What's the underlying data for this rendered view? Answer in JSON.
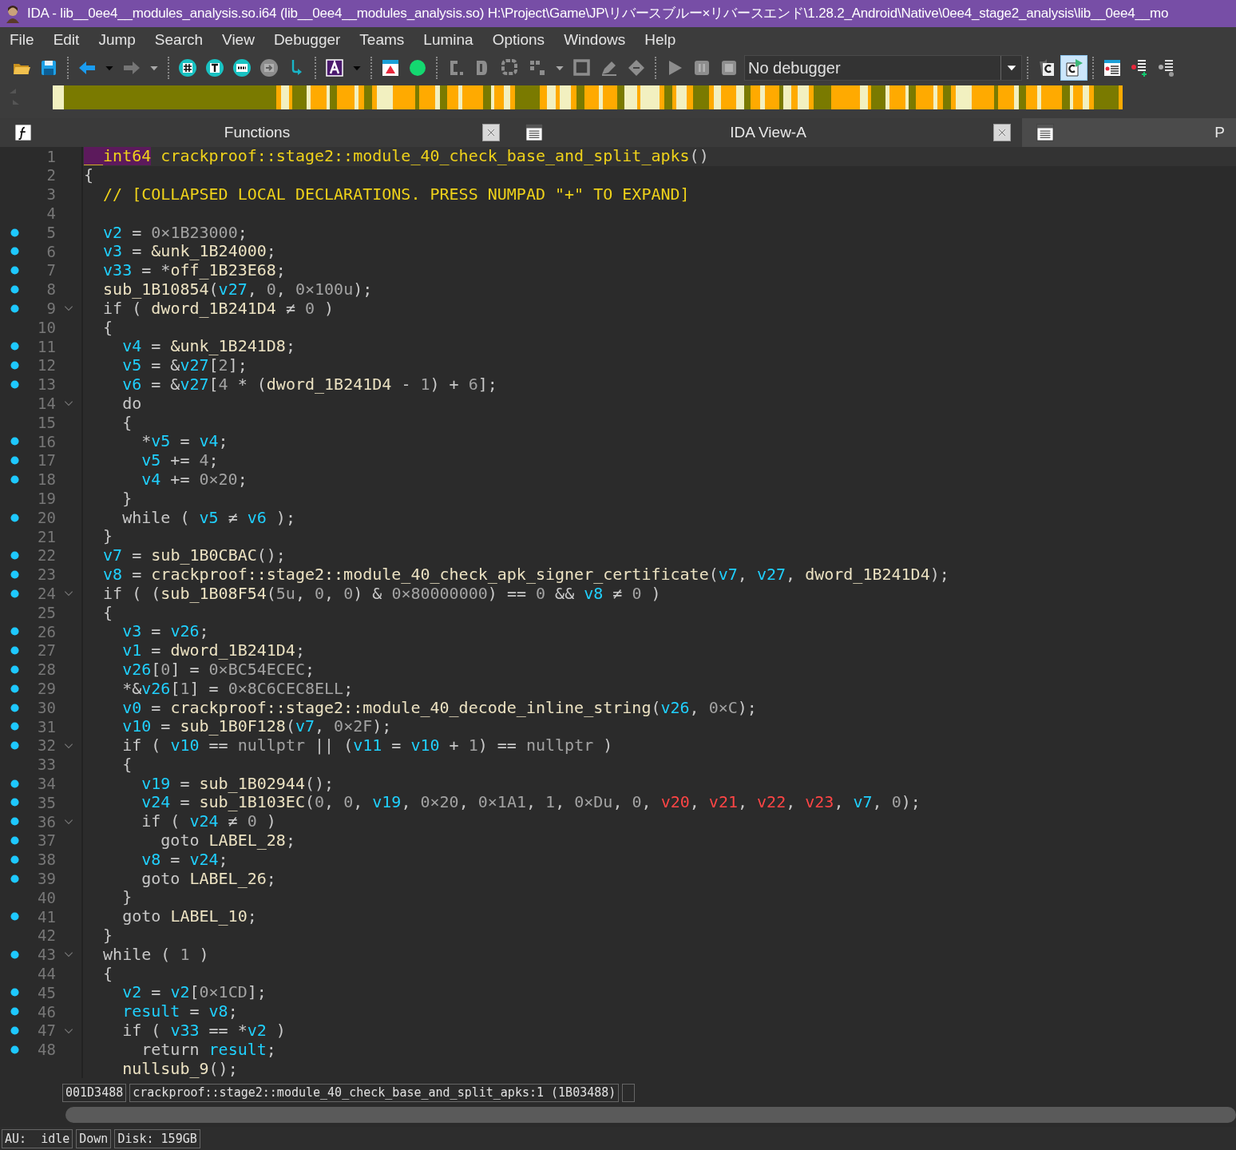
{
  "window": {
    "title": "IDA - lib__0ee4__modules_analysis.so.i64 (lib__0ee4__modules_analysis.so) H:\\Project\\Game\\JP\\リバースブルー×リバースエンド\\1.28.2_Android\\Native\\0ee4_stage2_analysis\\lib__0ee4__mo"
  },
  "menu": [
    "File",
    "Edit",
    "Jump",
    "Search",
    "View",
    "Debugger",
    "Teams",
    "Lumina",
    "Options",
    "Windows",
    "Help"
  ],
  "toolbar": [
    {
      "kind": "open",
      "disabled": false,
      "pressed": false
    },
    {
      "kind": "save",
      "disabled": false,
      "pressed": false
    },
    {
      "kind": "sep"
    },
    {
      "kind": "back",
      "disabled": false,
      "pressed": false
    },
    {
      "kind": "caret",
      "disabled": false,
      "pressed": false
    },
    {
      "kind": "forward",
      "disabled": true,
      "pressed": false
    },
    {
      "kind": "caret",
      "disabled": true,
      "pressed": false
    },
    {
      "kind": "sep"
    },
    {
      "kind": "hash",
      "disabled": false,
      "pressed": false
    },
    {
      "kind": "text",
      "disabled": false,
      "pressed": false
    },
    {
      "kind": "binary",
      "disabled": false,
      "pressed": false
    },
    {
      "kind": "jump",
      "disabled": true,
      "pressed": false
    },
    {
      "kind": "step",
      "disabled": false,
      "pressed": false
    },
    {
      "kind": "sep"
    },
    {
      "kind": "color",
      "disabled": false,
      "pressed": false
    },
    {
      "kind": "caret",
      "disabled": false,
      "pressed": false
    },
    {
      "kind": "sep"
    },
    {
      "kind": "flag",
      "disabled": false,
      "pressed": false
    },
    {
      "kind": "dot",
      "disabled": false,
      "pressed": false
    },
    {
      "kind": "sep"
    },
    {
      "kind": "code",
      "disabled": true,
      "pressed": false
    },
    {
      "kind": "data",
      "disabled": true,
      "pressed": false
    },
    {
      "kind": "struct",
      "disabled": true,
      "pressed": false
    },
    {
      "kind": "array",
      "disabled": true,
      "pressed": false
    },
    {
      "kind": "caret",
      "disabled": true,
      "pressed": false
    },
    {
      "kind": "bracket",
      "disabled": true,
      "pressed": false
    },
    {
      "kind": "pencil",
      "disabled": true,
      "pressed": false
    },
    {
      "kind": "diamond",
      "disabled": true,
      "pressed": false
    },
    {
      "kind": "sep"
    },
    {
      "kind": "play",
      "disabled": true,
      "pressed": false
    },
    {
      "kind": "pause",
      "disabled": true,
      "pressed": false
    },
    {
      "kind": "stop",
      "disabled": true,
      "pressed": false
    },
    {
      "kind": "select",
      "value": "No debugger"
    },
    {
      "kind": "sep"
    },
    {
      "kind": "doc-back",
      "disabled": false,
      "pressed": false
    },
    {
      "kind": "doc-play",
      "disabled": false,
      "pressed": true
    },
    {
      "kind": "sep"
    },
    {
      "kind": "list",
      "disabled": false,
      "pressed": false
    },
    {
      "kind": "list-add",
      "disabled": false,
      "pressed": false
    },
    {
      "kind": "list-gear",
      "disabled": false,
      "pressed": false
    }
  ],
  "tabs": [
    {
      "kind": "functions",
      "label": "Functions",
      "selected": false,
      "closable": true
    },
    {
      "kind": "view",
      "label": "IDA View-A",
      "selected": false,
      "closable": true
    },
    {
      "kind": "view",
      "label": "P",
      "selected": true,
      "closable": false
    }
  ],
  "code": [
    {
      "number": "1",
      "marker": false,
      "foldable": false,
      "selected": true,
      "tokens": [
        {
          "kind": "t",
          "text": "__int64"
        },
        {
          "kind": "c",
          "text": " crackproof::stage2::module_40_check_base_and_split_apks"
        },
        {
          "kind": "p",
          "text": "()"
        }
      ]
    },
    {
      "number": "2",
      "marker": false,
      "foldable": false,
      "selected": false,
      "tokens": [
        {
          "kind": "p",
          "text": "{"
        }
      ]
    },
    {
      "number": "3",
      "marker": false,
      "foldable": false,
      "selected": false,
      "tokens": [
        {
          "kind": "c",
          "text": "  // [COLLAPSED LOCAL DECLARATIONS. PRESS NUMPAD \"+\" TO EXPAND]"
        }
      ]
    },
    {
      "number": "4",
      "marker": false,
      "foldable": false,
      "selected": false
    },
    {
      "number": "5",
      "marker": true,
      "foldable": false,
      "selected": false,
      "tokens": [
        {
          "kind": "v",
          "text": "  v2"
        },
        {
          "kind": "p",
          "text": " = "
        },
        {
          "kind": "n",
          "text": "0×1B23000"
        },
        {
          "kind": "p",
          "text": ";"
        }
      ]
    },
    {
      "number": "6",
      "marker": true,
      "foldable": false,
      "selected": false,
      "tokens": [
        {
          "kind": "v",
          "text": "  v3"
        },
        {
          "kind": "p",
          "text": " = "
        },
        {
          "kind": "g",
          "text": "&unk_1B24000"
        },
        {
          "kind": "p",
          "text": ";"
        }
      ]
    },
    {
      "number": "7",
      "marker": true,
      "foldable": false,
      "selected": false,
      "tokens": [
        {
          "kind": "v",
          "text": "  v33"
        },
        {
          "kind": "p",
          "text": " = *"
        },
        {
          "kind": "g",
          "text": "off_1B23E68"
        },
        {
          "kind": "p",
          "text": ";"
        }
      ]
    },
    {
      "number": "8",
      "marker": true,
      "foldable": false,
      "selected": false,
      "tokens": [
        {
          "kind": "g",
          "text": "  sub_1B10854"
        },
        {
          "kind": "p",
          "text": "("
        },
        {
          "kind": "v",
          "text": "v27"
        },
        {
          "kind": "p",
          "text": ", "
        },
        {
          "kind": "n",
          "text": "0"
        },
        {
          "kind": "p",
          "text": ", "
        },
        {
          "kind": "n",
          "text": "0×100u"
        },
        {
          "kind": "p",
          "text": ");"
        }
      ]
    },
    {
      "number": "9",
      "marker": true,
      "foldable": true,
      "selected": false,
      "tokens": [
        {
          "kind": "p",
          "text": "  if ( "
        },
        {
          "kind": "g",
          "text": "dword_1B241D4"
        },
        {
          "kind": "p",
          "text": " ≠ "
        },
        {
          "kind": "n",
          "text": "0"
        },
        {
          "kind": "p",
          "text": " )"
        }
      ]
    },
    {
      "number": "10",
      "marker": false,
      "foldable": false,
      "selected": false,
      "tokens": [
        {
          "kind": "p",
          "text": "  {"
        }
      ]
    },
    {
      "number": "11",
      "marker": true,
      "foldable": false,
      "selected": false,
      "tokens": [
        {
          "kind": "v",
          "text": "    v4"
        },
        {
          "kind": "p",
          "text": " = "
        },
        {
          "kind": "g",
          "text": "&unk_1B241D8"
        },
        {
          "kind": "p",
          "text": ";"
        }
      ]
    },
    {
      "number": "12",
      "marker": true,
      "foldable": false,
      "selected": false,
      "tokens": [
        {
          "kind": "v",
          "text": "    v5"
        },
        {
          "kind": "p",
          "text": " = &"
        },
        {
          "kind": "v",
          "text": "v27"
        },
        {
          "kind": "p",
          "text": "["
        },
        {
          "kind": "n",
          "text": "2"
        },
        {
          "kind": "p",
          "text": "];"
        }
      ]
    },
    {
      "number": "13",
      "marker": true,
      "foldable": false,
      "selected": false,
      "tokens": [
        {
          "kind": "v",
          "text": "    v6"
        },
        {
          "kind": "p",
          "text": " = &"
        },
        {
          "kind": "v",
          "text": "v27"
        },
        {
          "kind": "p",
          "text": "["
        },
        {
          "kind": "n",
          "text": "4"
        },
        {
          "kind": "p",
          "text": " * ("
        },
        {
          "kind": "g",
          "text": "dword_1B241D4"
        },
        {
          "kind": "p",
          "text": " - "
        },
        {
          "kind": "n",
          "text": "1"
        },
        {
          "kind": "p",
          "text": ") + "
        },
        {
          "kind": "n",
          "text": "6"
        },
        {
          "kind": "p",
          "text": "];"
        }
      ]
    },
    {
      "number": "14",
      "marker": false,
      "foldable": true,
      "selected": false,
      "tokens": [
        {
          "kind": "p",
          "text": "    do"
        }
      ]
    },
    {
      "number": "15",
      "marker": false,
      "foldable": false,
      "selected": false,
      "tokens": [
        {
          "kind": "p",
          "text": "    {"
        }
      ]
    },
    {
      "number": "16",
      "marker": true,
      "foldable": false,
      "selected": false,
      "tokens": [
        {
          "kind": "p",
          "text": "      *"
        },
        {
          "kind": "v",
          "text": "v5"
        },
        {
          "kind": "p",
          "text": " = "
        },
        {
          "kind": "v",
          "text": "v4"
        },
        {
          "kind": "p",
          "text": ";"
        }
      ]
    },
    {
      "number": "17",
      "marker": true,
      "foldable": false,
      "selected": false,
      "tokens": [
        {
          "kind": "v",
          "text": "      v5"
        },
        {
          "kind": "p",
          "text": " += "
        },
        {
          "kind": "n",
          "text": "4"
        },
        {
          "kind": "p",
          "text": ";"
        }
      ]
    },
    {
      "number": "18",
      "marker": true,
      "foldable": false,
      "selected": false,
      "tokens": [
        {
          "kind": "v",
          "text": "      v4"
        },
        {
          "kind": "p",
          "text": " += "
        },
        {
          "kind": "n",
          "text": "0×20"
        },
        {
          "kind": "p",
          "text": ";"
        }
      ]
    },
    {
      "number": "19",
      "marker": false,
      "foldable": false,
      "selected": false,
      "tokens": [
        {
          "kind": "p",
          "text": "    }"
        }
      ]
    },
    {
      "number": "20",
      "marker": true,
      "foldable": false,
      "selected": false,
      "tokens": [
        {
          "kind": "p",
          "text": "    while ( "
        },
        {
          "kind": "v",
          "text": "v5"
        },
        {
          "kind": "p",
          "text": " ≠ "
        },
        {
          "kind": "v",
          "text": "v6"
        },
        {
          "kind": "p",
          "text": " );"
        }
      ]
    },
    {
      "number": "21",
      "marker": false,
      "foldable": false,
      "selected": false,
      "tokens": [
        {
          "kind": "p",
          "text": "  }"
        }
      ]
    },
    {
      "number": "22",
      "marker": true,
      "foldable": false,
      "selected": false,
      "tokens": [
        {
          "kind": "v",
          "text": "  v7"
        },
        {
          "kind": "p",
          "text": " = "
        },
        {
          "kind": "g",
          "text": "sub_1B0CBAC"
        },
        {
          "kind": "p",
          "text": "();"
        }
      ]
    },
    {
      "number": "23",
      "marker": true,
      "foldable": false,
      "selected": false,
      "tokens": [
        {
          "kind": "v",
          "text": "  v8"
        },
        {
          "kind": "p",
          "text": " = "
        },
        {
          "kind": "g",
          "text": "crackproof::stage2::module_40_check_apk_signer_certificate"
        },
        {
          "kind": "p",
          "text": "("
        },
        {
          "kind": "v",
          "text": "v7"
        },
        {
          "kind": "p",
          "text": ", "
        },
        {
          "kind": "v",
          "text": "v27"
        },
        {
          "kind": "p",
          "text": ", "
        },
        {
          "kind": "g",
          "text": "dword_1B241D4"
        },
        {
          "kind": "p",
          "text": ");"
        }
      ]
    },
    {
      "number": "24",
      "marker": true,
      "foldable": true,
      "selected": false,
      "tokens": [
        {
          "kind": "p",
          "text": "  if ( ("
        },
        {
          "kind": "g",
          "text": "sub_1B08F54"
        },
        {
          "kind": "p",
          "text": "("
        },
        {
          "kind": "n",
          "text": "5u"
        },
        {
          "kind": "p",
          "text": ", "
        },
        {
          "kind": "n",
          "text": "0"
        },
        {
          "kind": "p",
          "text": ", "
        },
        {
          "kind": "n",
          "text": "0"
        },
        {
          "kind": "p",
          "text": ") & "
        },
        {
          "kind": "n",
          "text": "0×80000000"
        },
        {
          "kind": "p",
          "text": ") == "
        },
        {
          "kind": "n",
          "text": "0"
        },
        {
          "kind": "p",
          "text": " && "
        },
        {
          "kind": "v",
          "text": "v8"
        },
        {
          "kind": "p",
          "text": " ≠ "
        },
        {
          "kind": "n",
          "text": "0"
        },
        {
          "kind": "p",
          "text": " )"
        }
      ]
    },
    {
      "number": "25",
      "marker": false,
      "foldable": false,
      "selected": false,
      "tokens": [
        {
          "kind": "p",
          "text": "  {"
        }
      ]
    },
    {
      "number": "26",
      "marker": true,
      "foldable": false,
      "selected": false,
      "tokens": [
        {
          "kind": "v",
          "text": "    v3"
        },
        {
          "kind": "p",
          "text": " = "
        },
        {
          "kind": "v",
          "text": "v26"
        },
        {
          "kind": "p",
          "text": ";"
        }
      ]
    },
    {
      "number": "27",
      "marker": true,
      "foldable": false,
      "selected": false,
      "tokens": [
        {
          "kind": "v",
          "text": "    v1"
        },
        {
          "kind": "p",
          "text": " = "
        },
        {
          "kind": "g",
          "text": "dword_1B241D4"
        },
        {
          "kind": "p",
          "text": ";"
        }
      ]
    },
    {
      "number": "28",
      "marker": true,
      "foldable": false,
      "selected": false,
      "tokens": [
        {
          "kind": "v",
          "text": "    v26"
        },
        {
          "kind": "p",
          "text": "["
        },
        {
          "kind": "n",
          "text": "0"
        },
        {
          "kind": "p",
          "text": "] = "
        },
        {
          "kind": "n",
          "text": "0×BC54ECEC"
        },
        {
          "kind": "p",
          "text": ";"
        }
      ]
    },
    {
      "number": "29",
      "marker": true,
      "foldable": false,
      "selected": false,
      "tokens": [
        {
          "kind": "p",
          "text": "    *&"
        },
        {
          "kind": "v",
          "text": "v26"
        },
        {
          "kind": "p",
          "text": "["
        },
        {
          "kind": "n",
          "text": "1"
        },
        {
          "kind": "p",
          "text": "] = "
        },
        {
          "kind": "n",
          "text": "0×8C6CEC8ELL"
        },
        {
          "kind": "p",
          "text": ";"
        }
      ]
    },
    {
      "number": "30",
      "marker": true,
      "foldable": false,
      "selected": false,
      "tokens": [
        {
          "kind": "v",
          "text": "    v0"
        },
        {
          "kind": "p",
          "text": " = "
        },
        {
          "kind": "g",
          "text": "crackproof::stage2::module_40_decode_inline_string"
        },
        {
          "kind": "p",
          "text": "("
        },
        {
          "kind": "v",
          "text": "v26"
        },
        {
          "kind": "p",
          "text": ", "
        },
        {
          "kind": "n",
          "text": "0×C"
        },
        {
          "kind": "p",
          "text": ");"
        }
      ]
    },
    {
      "number": "31",
      "marker": true,
      "foldable": false,
      "selected": false,
      "tokens": [
        {
          "kind": "v",
          "text": "    v10"
        },
        {
          "kind": "p",
          "text": " = "
        },
        {
          "kind": "g",
          "text": "sub_1B0F128"
        },
        {
          "kind": "p",
          "text": "("
        },
        {
          "kind": "v",
          "text": "v7"
        },
        {
          "kind": "p",
          "text": ", "
        },
        {
          "kind": "n",
          "text": "0×2F"
        },
        {
          "kind": "p",
          "text": ");"
        }
      ]
    },
    {
      "number": "32",
      "marker": true,
      "foldable": true,
      "selected": false,
      "tokens": [
        {
          "kind": "p",
          "text": "    if ( "
        },
        {
          "kind": "v",
          "text": "v10"
        },
        {
          "kind": "p",
          "text": " == "
        },
        {
          "kind": "n",
          "text": "nullptr"
        },
        {
          "kind": "p",
          "text": " || ("
        },
        {
          "kind": "v",
          "text": "v11"
        },
        {
          "kind": "p",
          "text": " = "
        },
        {
          "kind": "v",
          "text": "v10"
        },
        {
          "kind": "p",
          "text": " + "
        },
        {
          "kind": "n",
          "text": "1"
        },
        {
          "kind": "p",
          "text": ") == "
        },
        {
          "kind": "n",
          "text": "nullptr"
        },
        {
          "kind": "p",
          "text": " )"
        }
      ]
    },
    {
      "number": "33",
      "marker": false,
      "foldable": false,
      "selected": false,
      "tokens": [
        {
          "kind": "p",
          "text": "    {"
        }
      ]
    },
    {
      "number": "34",
      "marker": true,
      "foldable": false,
      "selected": false,
      "tokens": [
        {
          "kind": "v",
          "text": "      v19"
        },
        {
          "kind": "p",
          "text": " = "
        },
        {
          "kind": "g",
          "text": "sub_1B02944"
        },
        {
          "kind": "p",
          "text": "();"
        }
      ]
    },
    {
      "number": "35",
      "marker": true,
      "foldable": false,
      "selected": false,
      "tokens": [
        {
          "kind": "v",
          "text": "      v24"
        },
        {
          "kind": "p",
          "text": " = "
        },
        {
          "kind": "g",
          "text": "sub_1B103EC"
        },
        {
          "kind": "p",
          "text": "("
        },
        {
          "kind": "n",
          "text": "0"
        },
        {
          "kind": "p",
          "text": ", "
        },
        {
          "kind": "n",
          "text": "0"
        },
        {
          "kind": "p",
          "text": ", "
        },
        {
          "kind": "v",
          "text": "v19"
        },
        {
          "kind": "p",
          "text": ", "
        },
        {
          "kind": "n",
          "text": "0×20"
        },
        {
          "kind": "p",
          "text": ", "
        },
        {
          "kind": "n",
          "text": "0×1A1"
        },
        {
          "kind": "p",
          "text": ", "
        },
        {
          "kind": "n",
          "text": "1"
        },
        {
          "kind": "p",
          "text": ", "
        },
        {
          "kind": "n",
          "text": "0×Du"
        },
        {
          "kind": "p",
          "text": ", "
        },
        {
          "kind": "n",
          "text": "0"
        },
        {
          "kind": "p",
          "text": ", "
        },
        {
          "kind": "r",
          "text": "v20"
        },
        {
          "kind": "p",
          "text": ", "
        },
        {
          "kind": "r",
          "text": "v21"
        },
        {
          "kind": "p",
          "text": ", "
        },
        {
          "kind": "r",
          "text": "v22"
        },
        {
          "kind": "p",
          "text": ", "
        },
        {
          "kind": "r",
          "text": "v23"
        },
        {
          "kind": "p",
          "text": ", "
        },
        {
          "kind": "v",
          "text": "v7"
        },
        {
          "kind": "p",
          "text": ", "
        },
        {
          "kind": "n",
          "text": "0"
        },
        {
          "kind": "p",
          "text": ");"
        }
      ]
    },
    {
      "number": "36",
      "marker": true,
      "foldable": true,
      "selected": false,
      "tokens": [
        {
          "kind": "p",
          "text": "      if ( "
        },
        {
          "kind": "v",
          "text": "v24"
        },
        {
          "kind": "p",
          "text": " ≠ "
        },
        {
          "kind": "n",
          "text": "0"
        },
        {
          "kind": "p",
          "text": " )"
        }
      ]
    },
    {
      "number": "37",
      "marker": true,
      "foldable": false,
      "selected": false,
      "tokens": [
        {
          "kind": "p",
          "text": "        goto "
        },
        {
          "kind": "g",
          "text": "LABEL_28"
        },
        {
          "kind": "p",
          "text": ";"
        }
      ]
    },
    {
      "number": "38",
      "marker": true,
      "foldable": false,
      "selected": false,
      "tokens": [
        {
          "kind": "v",
          "text": "      v8"
        },
        {
          "kind": "p",
          "text": " = "
        },
        {
          "kind": "v",
          "text": "v24"
        },
        {
          "kind": "p",
          "text": ";"
        }
      ]
    },
    {
      "number": "39",
      "marker": true,
      "foldable": false,
      "selected": false,
      "tokens": [
        {
          "kind": "p",
          "text": "      goto "
        },
        {
          "kind": "g",
          "text": "LABEL_26"
        },
        {
          "kind": "p",
          "text": ";"
        }
      ]
    },
    {
      "number": "40",
      "marker": false,
      "foldable": false,
      "selected": false,
      "tokens": [
        {
          "kind": "p",
          "text": "    }"
        }
      ]
    },
    {
      "number": "41",
      "marker": true,
      "foldable": false,
      "selected": false,
      "tokens": [
        {
          "kind": "p",
          "text": "    goto "
        },
        {
          "kind": "g",
          "text": "LABEL_10"
        },
        {
          "kind": "p",
          "text": ";"
        }
      ]
    },
    {
      "number": "42",
      "marker": false,
      "foldable": false,
      "selected": false,
      "tokens": [
        {
          "kind": "p",
          "text": "  }"
        }
      ]
    },
    {
      "number": "43",
      "marker": true,
      "foldable": true,
      "selected": false,
      "tokens": [
        {
          "kind": "p",
          "text": "  while ( "
        },
        {
          "kind": "n",
          "text": "1"
        },
        {
          "kind": "p",
          "text": " )"
        }
      ]
    },
    {
      "number": "44",
      "marker": false,
      "foldable": false,
      "selected": false,
      "tokens": [
        {
          "kind": "p",
          "text": "  {"
        }
      ]
    },
    {
      "number": "45",
      "marker": true,
      "foldable": false,
      "selected": false,
      "tokens": [
        {
          "kind": "v",
          "text": "    v2"
        },
        {
          "kind": "p",
          "text": " = "
        },
        {
          "kind": "v",
          "text": "v2"
        },
        {
          "kind": "p",
          "text": "["
        },
        {
          "kind": "n",
          "text": "0×1CD"
        },
        {
          "kind": "p",
          "text": "];"
        }
      ]
    },
    {
      "number": "46",
      "marker": true,
      "foldable": false,
      "selected": false,
      "tokens": [
        {
          "kind": "v",
          "text": "    result"
        },
        {
          "kind": "p",
          "text": " = "
        },
        {
          "kind": "v",
          "text": "v8"
        },
        {
          "kind": "p",
          "text": ";"
        }
      ]
    },
    {
      "number": "47",
      "marker": true,
      "foldable": true,
      "selected": false,
      "tokens": [
        {
          "kind": "p",
          "text": "    if ( "
        },
        {
          "kind": "v",
          "text": "v33"
        },
        {
          "kind": "p",
          "text": " == *"
        },
        {
          "kind": "v",
          "text": "v2"
        },
        {
          "kind": "p",
          "text": " )"
        }
      ]
    },
    {
      "number": "48",
      "marker": true,
      "foldable": false,
      "selected": false,
      "tokens": [
        {
          "kind": "p",
          "text": "      return "
        },
        {
          "kind": "v",
          "text": "result"
        },
        {
          "kind": "p",
          "text": ";"
        }
      ]
    },
    {
      "marker": false,
      "foldable": false,
      "selected": false,
      "tokens": [
        {
          "kind": "g",
          "text": "    nullsub_9"
        },
        {
          "kind": "p",
          "text": "();"
        }
      ]
    }
  ],
  "location": {
    "address": "001D3488",
    "function": "crackproof::stage2::module_40_check_base_and_split_apks:1 (1B03488)"
  },
  "status_bar": [
    "AU:  idle",
    "Down",
    "Disk: 159GB"
  ]
}
